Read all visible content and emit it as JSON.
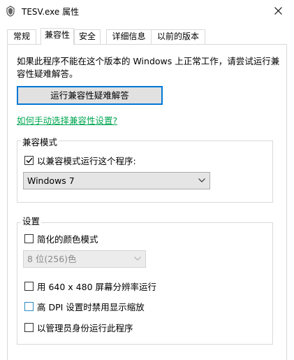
{
  "window": {
    "title": "TESV.exe 属性",
    "close_icon": "close-icon"
  },
  "tabs": [
    {
      "label": "常规"
    },
    {
      "label": "兼容性"
    },
    {
      "label": "安全"
    },
    {
      "label": "详细信息"
    },
    {
      "label": "以前的版本"
    }
  ],
  "content": {
    "description": "如果此程序不能在这个版本的 Windows 上正常工作，请尝试运行兼容性疑难解答。",
    "troubleshooter_button": "运行兼容性疑难解答",
    "manual_link": "如何手动选择兼容性设置?"
  },
  "compat_mode": {
    "title": "兼容模式",
    "run_in_compat_label": "以兼容模式运行这个程序:",
    "run_in_compat_checked": true,
    "os_selected": "Windows 7"
  },
  "settings": {
    "title": "设置",
    "reduced_color_label": "简化的颜色模式",
    "reduced_color_checked": false,
    "color_depth_selected": "8 位(256)色",
    "resolution_label": "用 640 x 480 屏幕分辨率运行",
    "resolution_checked": false,
    "dpi_label": "高 DPI 设置时禁用显示缩放",
    "dpi_checked": false,
    "admin_label": "以管理员身份运行此程序",
    "admin_checked": false
  },
  "colors": {
    "accent": "#0078d7",
    "link": "#00a651"
  }
}
